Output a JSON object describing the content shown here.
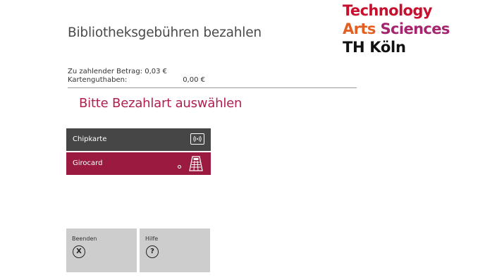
{
  "header": {
    "title": "Bibliotheksgebühren bezahlen"
  },
  "logo": {
    "line1": "Technology",
    "line2_part1": "Arts",
    "line2_part2": "Sciences",
    "line3": "TH Köln",
    "colors": {
      "technology": "#c8102e",
      "arts": "#e35f22",
      "sciences": "#a3266f",
      "th_koeln": "#111111"
    }
  },
  "summary": {
    "amount_due": "Zu zahlender Betrag: 0,03 €",
    "card_balance_label": "Kartenguthaben:",
    "card_balance_value": "0,00 €"
  },
  "payment": {
    "prompt": "Bitte Bezahlart auswählen",
    "options": [
      {
        "label": "Chipkarte",
        "icon": "contactless-card-icon",
        "color": "#464646"
      },
      {
        "label": "Girocard",
        "icon": "card-terminal-icon",
        "color": "#9b1a40"
      }
    ]
  },
  "footer": {
    "buttons": [
      {
        "label": "Beenden",
        "icon": "close-circle-icon",
        "glyph": "X"
      },
      {
        "label": "Hilfe",
        "icon": "help-circle-icon",
        "glyph": "?"
      }
    ]
  },
  "colors": {
    "accent": "#b0204e",
    "divider": "#9a9a9a",
    "footer_button_bg": "#cdcdcd"
  }
}
